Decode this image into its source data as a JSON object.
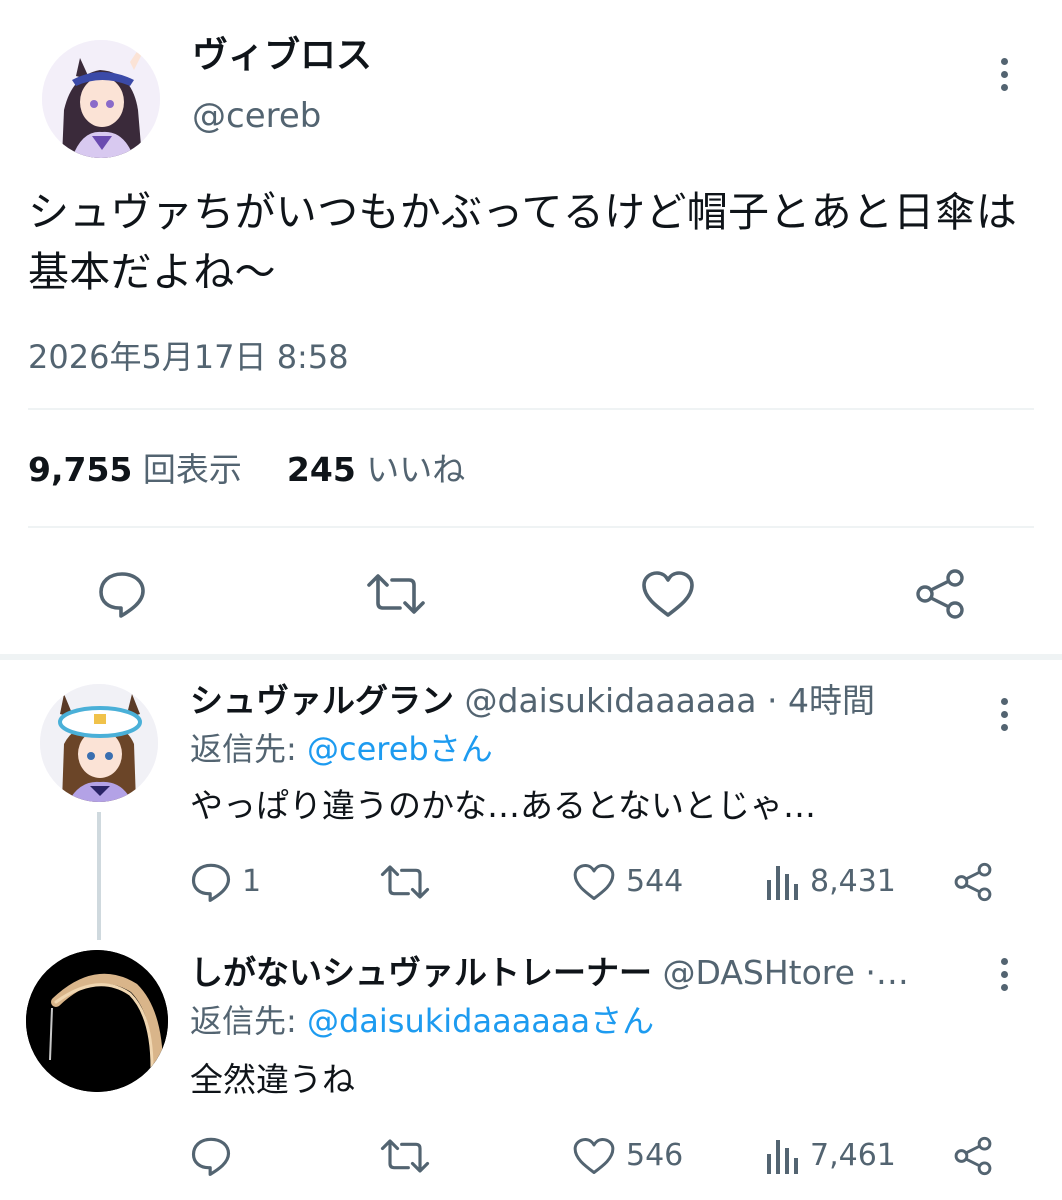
{
  "main_tweet": {
    "display_name": "ヴィブロス",
    "handle": "@cereb",
    "text": "シュヴァちがいつもかぶってるけど帽子とあと日傘は基本だよね〜",
    "timestamp": "2026年5月17日 8:58",
    "views_count": "9,755",
    "views_label": "回表示",
    "likes_count": "245",
    "likes_label": "いいね"
  },
  "replies": [
    {
      "display_name": "シュヴァルグラン",
      "handle_time": "@daisukidaaaaaa · 4時間",
      "reply_prefix": "返信先: ",
      "reply_mention": "@cerebさん",
      "text": "やっぱり違うのかな…あるとないとじゃ…",
      "reply_count": "1",
      "like_count": "544",
      "view_count": "8,431"
    },
    {
      "display_name": "しがないシュヴァルトレーナー",
      "handle_time": "@DASHtore ·…",
      "reply_prefix": "返信先: ",
      "reply_mention": "@daisukidaaaaaaさん",
      "text": "全然違うね",
      "reply_count": "",
      "like_count": "546",
      "view_count": "7,461"
    }
  ],
  "colors": {
    "text_primary": "#0f1419",
    "text_secondary": "#536471",
    "accent": "#1d9bf0",
    "divider": "#eff3f4",
    "icon": "#536471"
  },
  "icons": {
    "reply": "speech-bubble-icon",
    "retweet": "retweet-arrows-icon",
    "like": "heart-icon",
    "share": "share-icon",
    "views": "bar-chart-icon",
    "more": "vertical-ellipsis-icon"
  }
}
